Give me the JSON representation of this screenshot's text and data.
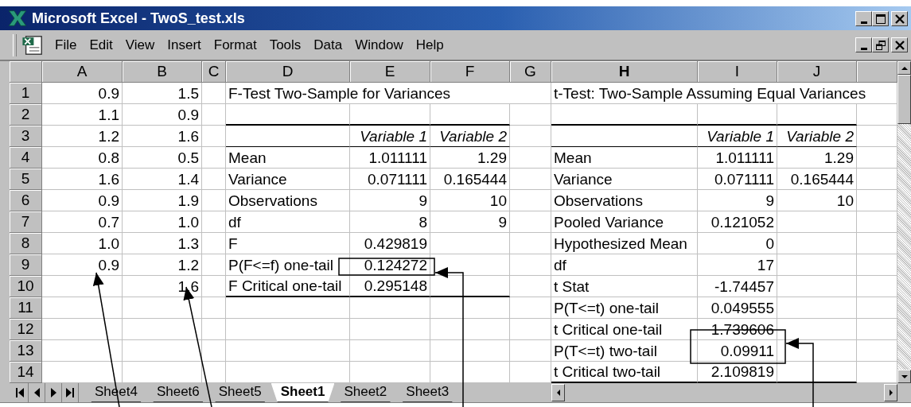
{
  "window": {
    "title": "Microsoft Excel - TwoS_test.xls"
  },
  "menu": [
    "File",
    "Edit",
    "View",
    "Insert",
    "Format",
    "Tools",
    "Data",
    "Window",
    "Help"
  ],
  "columns": [
    {
      "label": "A",
      "selected": false
    },
    {
      "label": "B",
      "selected": false
    },
    {
      "label": "C",
      "selected": false
    },
    {
      "label": "D",
      "selected": false
    },
    {
      "label": "E",
      "selected": false
    },
    {
      "label": "F",
      "selected": false
    },
    {
      "label": "G",
      "selected": false
    },
    {
      "label": "H",
      "selected": true
    },
    {
      "label": "I",
      "selected": false
    },
    {
      "label": "J",
      "selected": false
    }
  ],
  "rows": [
    {
      "number": "1",
      "cells": [
        {
          "text": "0.9",
          "kind": "number"
        },
        {
          "text": "1.5",
          "kind": "number"
        },
        null,
        {
          "text": "F-Test Two-Sample for Variances",
          "kind": "label"
        },
        null,
        null,
        null,
        {
          "text": "t-Test: Two-Sample Assuming Equal Variances",
          "kind": "label"
        },
        null,
        null
      ]
    },
    {
      "number": "2",
      "cells": [
        {
          "text": "1.1",
          "kind": "number"
        },
        {
          "text": "0.9",
          "kind": "number"
        },
        null,
        null,
        null,
        null,
        null,
        null,
        null,
        null
      ]
    },
    {
      "number": "3",
      "cells": [
        {
          "text": "1.2",
          "kind": "number"
        },
        {
          "text": "1.6",
          "kind": "number"
        },
        null,
        null,
        {
          "text": "Variable 1",
          "kind": "heading"
        },
        {
          "text": "Variable 2",
          "kind": "heading"
        },
        null,
        null,
        {
          "text": "Variable 1",
          "kind": "heading"
        },
        {
          "text": "Variable 2",
          "kind": "heading"
        }
      ]
    },
    {
      "number": "4",
      "cells": [
        {
          "text": "0.8",
          "kind": "number"
        },
        {
          "text": "0.5",
          "kind": "number"
        },
        null,
        {
          "text": "Mean",
          "kind": "label"
        },
        {
          "text": "1.011111",
          "kind": "number"
        },
        {
          "text": "1.29",
          "kind": "number"
        },
        null,
        {
          "text": "Mean",
          "kind": "label"
        },
        {
          "text": "1.011111",
          "kind": "number"
        },
        {
          "text": "1.29",
          "kind": "number"
        }
      ]
    },
    {
      "number": "5",
      "cells": [
        {
          "text": "1.6",
          "kind": "number"
        },
        {
          "text": "1.4",
          "kind": "number"
        },
        null,
        {
          "text": "Variance",
          "kind": "label"
        },
        {
          "text": "0.071111",
          "kind": "number"
        },
        {
          "text": "0.165444",
          "kind": "number"
        },
        null,
        {
          "text": "Variance",
          "kind": "label"
        },
        {
          "text": "0.071111",
          "kind": "number"
        },
        {
          "text": "0.165444",
          "kind": "number"
        }
      ]
    },
    {
      "number": "6",
      "cells": [
        {
          "text": "0.9",
          "kind": "number"
        },
        {
          "text": "1.9",
          "kind": "number"
        },
        null,
        {
          "text": "Observations",
          "kind": "label"
        },
        {
          "text": "9",
          "kind": "number"
        },
        {
          "text": "10",
          "kind": "number"
        },
        null,
        {
          "text": "Observations",
          "kind": "label"
        },
        {
          "text": "9",
          "kind": "number"
        },
        {
          "text": "10",
          "kind": "number"
        }
      ]
    },
    {
      "number": "7",
      "cells": [
        {
          "text": "0.7",
          "kind": "number"
        },
        {
          "text": "1.0",
          "kind": "number"
        },
        null,
        {
          "text": "df",
          "kind": "label"
        },
        {
          "text": "8",
          "kind": "number"
        },
        {
          "text": "9",
          "kind": "number"
        },
        null,
        {
          "text": "Pooled Variance",
          "kind": "label"
        },
        {
          "text": "0.121052",
          "kind": "number"
        },
        null
      ]
    },
    {
      "number": "8",
      "cells": [
        {
          "text": "1.0",
          "kind": "number"
        },
        {
          "text": "1.3",
          "kind": "number"
        },
        null,
        {
          "text": "F",
          "kind": "label"
        },
        {
          "text": "0.429819",
          "kind": "number"
        },
        null,
        null,
        {
          "text": "Hypothesized Mean",
          "kind": "label"
        },
        {
          "text": "0",
          "kind": "number"
        },
        null
      ]
    },
    {
      "number": "9",
      "cells": [
        {
          "text": "0.9",
          "kind": "number"
        },
        {
          "text": "1.2",
          "kind": "number"
        },
        null,
        {
          "text": "P(F<=f) one-tail",
          "kind": "label"
        },
        {
          "text": "0.124272",
          "kind": "number"
        },
        null,
        null,
        {
          "text": "df",
          "kind": "label"
        },
        {
          "text": "17",
          "kind": "number"
        },
        null
      ]
    },
    {
      "number": "10",
      "cells": [
        null,
        {
          "text": "1.6",
          "kind": "number"
        },
        null,
        {
          "text": "F Critical one-tail",
          "kind": "label"
        },
        {
          "text": "0.295148",
          "kind": "number"
        },
        null,
        null,
        {
          "text": "t Stat",
          "kind": "label"
        },
        {
          "text": "-1.74457",
          "kind": "number"
        },
        null
      ]
    },
    {
      "number": "11",
      "cells": [
        null,
        null,
        null,
        null,
        null,
        null,
        null,
        {
          "text": "P(T<=t) one-tail",
          "kind": "label"
        },
        {
          "text": "0.049555",
          "kind": "number"
        },
        null
      ]
    },
    {
      "number": "12",
      "cells": [
        null,
        null,
        null,
        null,
        null,
        null,
        null,
        {
          "text": "t Critical one-tail",
          "kind": "label"
        },
        {
          "text": "1.739606",
          "kind": "number"
        },
        null
      ]
    },
    {
      "number": "13",
      "cells": [
        null,
        null,
        null,
        null,
        null,
        null,
        null,
        {
          "text": "P(T<=t) two-tail",
          "kind": "label"
        },
        {
          "text": "0.09911",
          "kind": "number"
        },
        null
      ]
    },
    {
      "number": "14",
      "cells": [
        null,
        null,
        null,
        null,
        null,
        null,
        null,
        {
          "text": "t Critical two-tail",
          "kind": "label"
        },
        {
          "text": "2.109819",
          "kind": "number"
        },
        null
      ]
    }
  ],
  "sheet_tabs": [
    {
      "label": "Sheet4",
      "selected": false
    },
    {
      "label": "Sheet6",
      "selected": false
    },
    {
      "label": "Sheet5",
      "selected": false
    },
    {
      "label": "Sheet1",
      "selected": true
    },
    {
      "label": "Sheet2",
      "selected": false
    },
    {
      "label": "Sheet3",
      "selected": false
    }
  ]
}
